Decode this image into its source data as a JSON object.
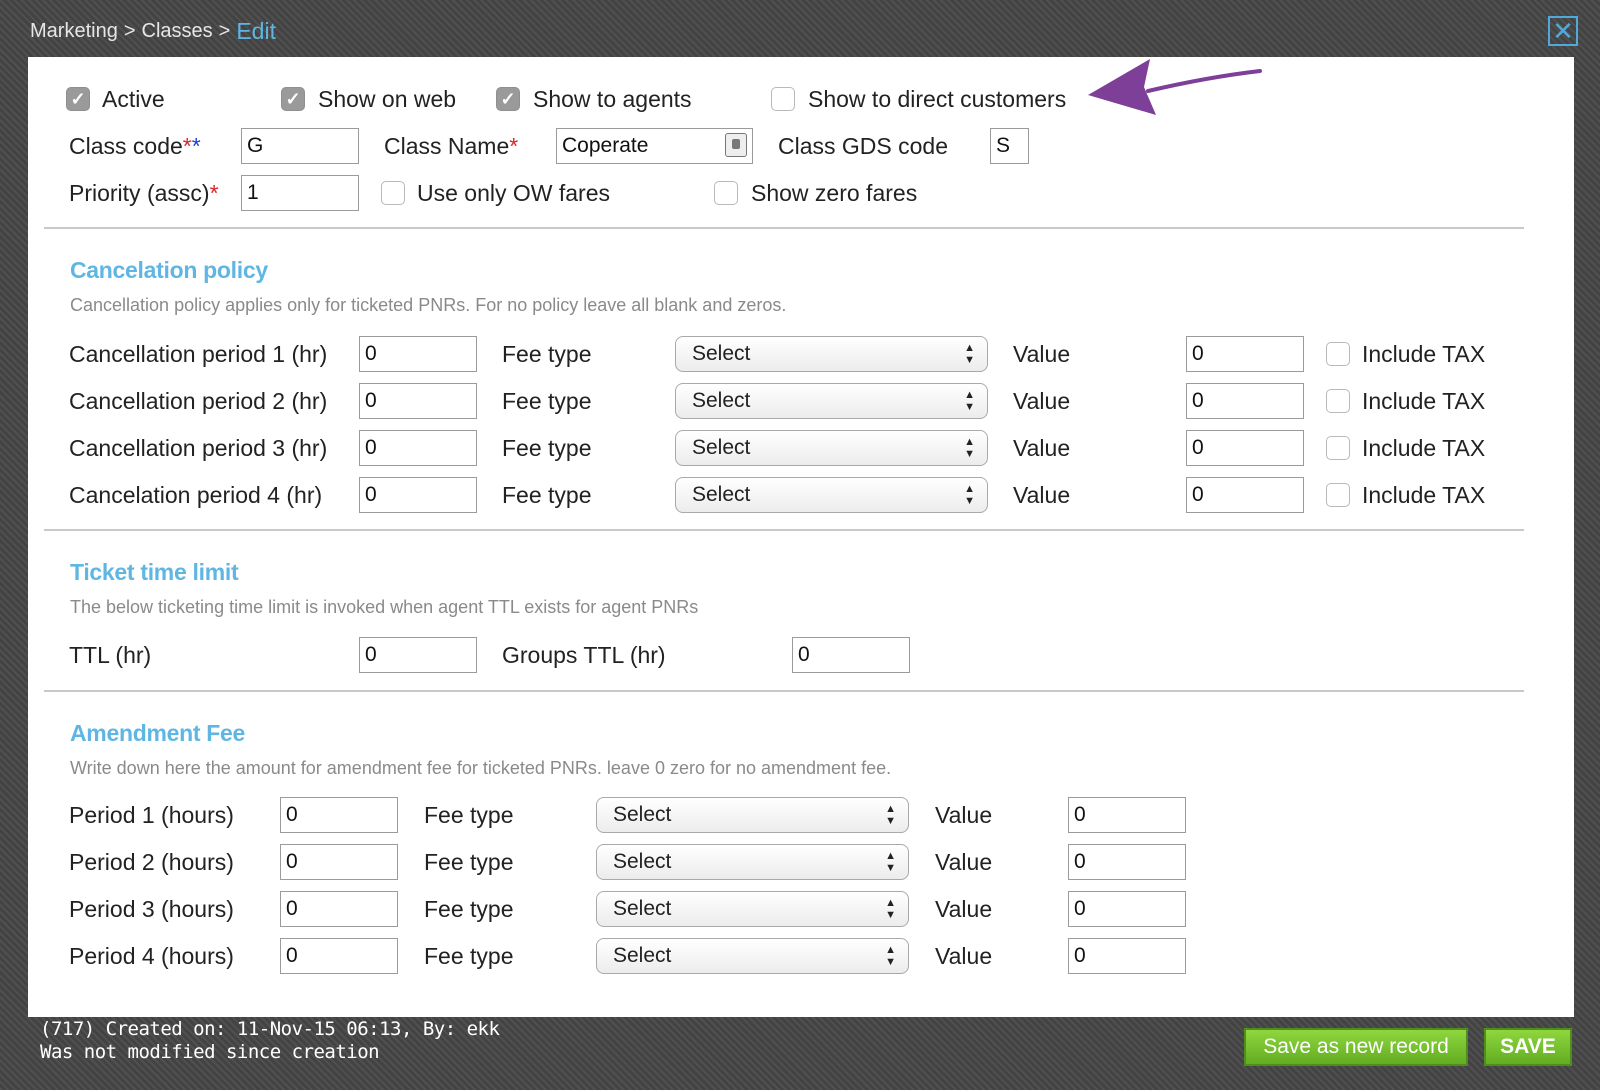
{
  "breadcrumb": {
    "part1": "Marketing",
    "sep": ">",
    "part2": "Classes",
    "current": "Edit"
  },
  "close_icon": "✕",
  "flags": {
    "active": {
      "label": "Active",
      "checked": true
    },
    "show_on_web": {
      "label": "Show on web",
      "checked": true
    },
    "show_to_agents": {
      "label": "Show to agents",
      "checked": true
    },
    "show_to_direct": {
      "label": "Show to direct customers",
      "checked": false
    }
  },
  "class_code": {
    "label": "Class code",
    "req": "**",
    "value": "G"
  },
  "class_name": {
    "label": "Class Name",
    "req": "*",
    "value": "Coperate"
  },
  "class_gds": {
    "label": "Class GDS code",
    "value": "S"
  },
  "priority": {
    "label": "Priority (assc)",
    "req": "*",
    "value": "1"
  },
  "use_ow": {
    "label": "Use only OW fares",
    "checked": false
  },
  "show_zero": {
    "label": "Show zero fares",
    "checked": false
  },
  "cancellation": {
    "title": "Cancelation policy",
    "desc": "Cancellation policy applies only for ticketed PNRs. For no policy leave all blank and zeros.",
    "rows": [
      {
        "label": "Cancellation period 1 (hr)",
        "period": "0",
        "fee_label": "Fee type",
        "fee": "Select",
        "value_label": "Value",
        "value": "0",
        "tax_label": "Include TAX"
      },
      {
        "label": "Cancellation period 2 (hr)",
        "period": "0",
        "fee_label": "Fee type",
        "fee": "Select",
        "value_label": "Value",
        "value": "0",
        "tax_label": "Include TAX"
      },
      {
        "label": "Cancellation period 3 (hr)",
        "period": "0",
        "fee_label": "Fee type",
        "fee": "Select",
        "value_label": "Value",
        "value": "0",
        "tax_label": "Include TAX"
      },
      {
        "label": "Cancelation period 4 (hr)",
        "period": "0",
        "fee_label": "Fee type",
        "fee": "Select",
        "value_label": "Value",
        "value": "0",
        "tax_label": "Include TAX"
      }
    ]
  },
  "ttl": {
    "title": "Ticket time limit",
    "desc": "The below ticketing time limit is invoked when agent TTL exists for agent PNRs",
    "ttl_label": "TTL (hr)",
    "ttl_value": "0",
    "groups_label": "Groups TTL (hr)",
    "groups_value": "0"
  },
  "amendment": {
    "title": "Amendment Fee",
    "desc": "Write down here the amount for amendment fee for ticketed PNRs. leave 0 zero for no amendment fee.",
    "rows": [
      {
        "label": "Period 1 (hours)",
        "period": "0",
        "fee_label": "Fee type",
        "fee": "Select",
        "value_label": "Value",
        "value": "0"
      },
      {
        "label": "Period 2 (hours)",
        "period": "0",
        "fee_label": "Fee type",
        "fee": "Select",
        "value_label": "Value",
        "value": "0"
      },
      {
        "label": "Period 3 (hours)",
        "period": "0",
        "fee_label": "Fee type",
        "fee": "Select",
        "value_label": "Value",
        "value": "0"
      },
      {
        "label": "Period 4 (hours)",
        "period": "0",
        "fee_label": "Fee type",
        "fee": "Select",
        "value_label": "Value",
        "value": "0"
      }
    ]
  },
  "footer": {
    "created": "(717) Created on: 11-Nov-15 06:13, By: ekk",
    "modified": "Was not modified since creation",
    "save_new": "Save as new record",
    "save": "SAVE"
  },
  "colors": {
    "accent": "#5fb6e3",
    "annotation_arrow": "#7d3f98",
    "save_green": "#6fbf2a",
    "required_red": "#e02424",
    "required_blue": "#1f3fd1"
  }
}
